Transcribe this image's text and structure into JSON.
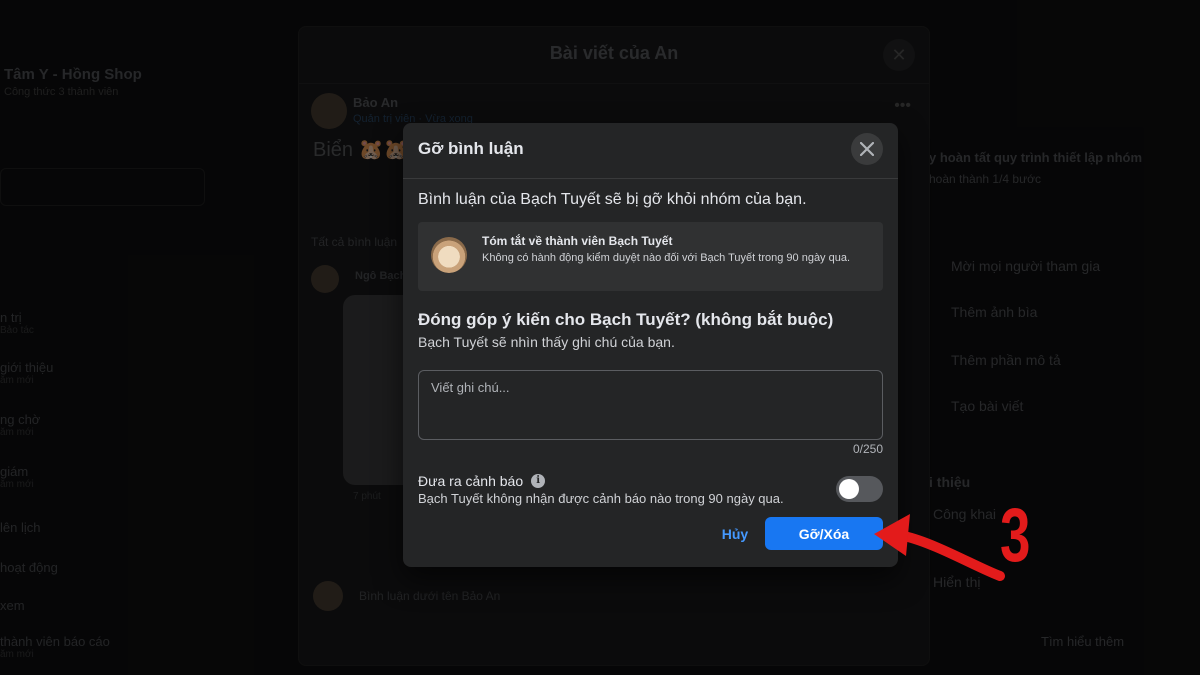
{
  "background": {
    "left_sidebar": {
      "group_name": "Tâm Y - Hồng Shop",
      "group_sub": "Công thức 3 thành viên",
      "items": [
        {
          "label": "n trị",
          "sub": "Bảo tác"
        },
        {
          "label": "giới thiệu",
          "sub": "ăm mới"
        },
        {
          "label": "ng chờ",
          "sub": "ăm mới"
        },
        {
          "label": "giám",
          "sub": "ăm mới"
        },
        {
          "label": "lên lịch",
          "sub": ""
        },
        {
          "label": "hoạt động",
          "sub": ""
        },
        {
          "label": "xem",
          "sub": ""
        },
        {
          "label": "thành viên báo cáo",
          "sub": "ăm mới"
        }
      ]
    },
    "post_panel": {
      "title": "Bài viết của An",
      "author": "Bảo An",
      "author_role": "Quản trị viên · Vừa xong",
      "content": "Biển 🐹🐹",
      "comments_header": "Tất cả bình luận",
      "commenter": "Ngô Bạch Tuyết",
      "comment_time": "7 phút",
      "comment_input_placeholder": "Bình luận dưới tên Bảo An"
    },
    "right_sidebar": {
      "setup_title": "y hoàn tất quy trình thiết lập nhóm",
      "setup_progress": "hoàn thành 1/4 bước",
      "steps": [
        "Mời mọi người tham gia",
        "Thêm ảnh bìa",
        "Thêm phần mô tả",
        "Tạo bài viết"
      ],
      "about_title": "i thiệu",
      "public_label": "Công khai",
      "visible_label": "Hiển thị",
      "learn_more": "Tìm hiểu thêm"
    }
  },
  "modal": {
    "title": "Gỡ bình luận",
    "description": "Bình luận của Bạch Tuyết sẽ bị gỡ khỏi nhóm của bạn.",
    "summary_title": "Tóm tắt về thành viên Bạch Tuyết",
    "summary_text": "Không có hành động kiểm duyệt nào đối với Bạch Tuyết trong 90 ngày qua.",
    "feedback_title": "Đóng góp ý kiến cho Bạch Tuyết? (không bắt buộc)",
    "feedback_sub": "Bạch Tuyết sẽ nhìn thấy ghi chú của bạn.",
    "note_placeholder": "Viết ghi chú...",
    "note_value": "",
    "char_counter": "0/250",
    "warning_label": "Đưa ra cảnh báo",
    "warning_sub": "Bạch Tuyết không nhận được cảnh báo nào trong 90 ngày qua.",
    "warning_enabled": false,
    "cancel_label": "Hủy",
    "remove_label": "Gỡ/Xóa"
  },
  "annotation": {
    "step_number": "3",
    "color": "#e31b1b"
  },
  "colors": {
    "accent": "#1877f2",
    "link": "#4599ff",
    "modal_bg": "#242526"
  }
}
